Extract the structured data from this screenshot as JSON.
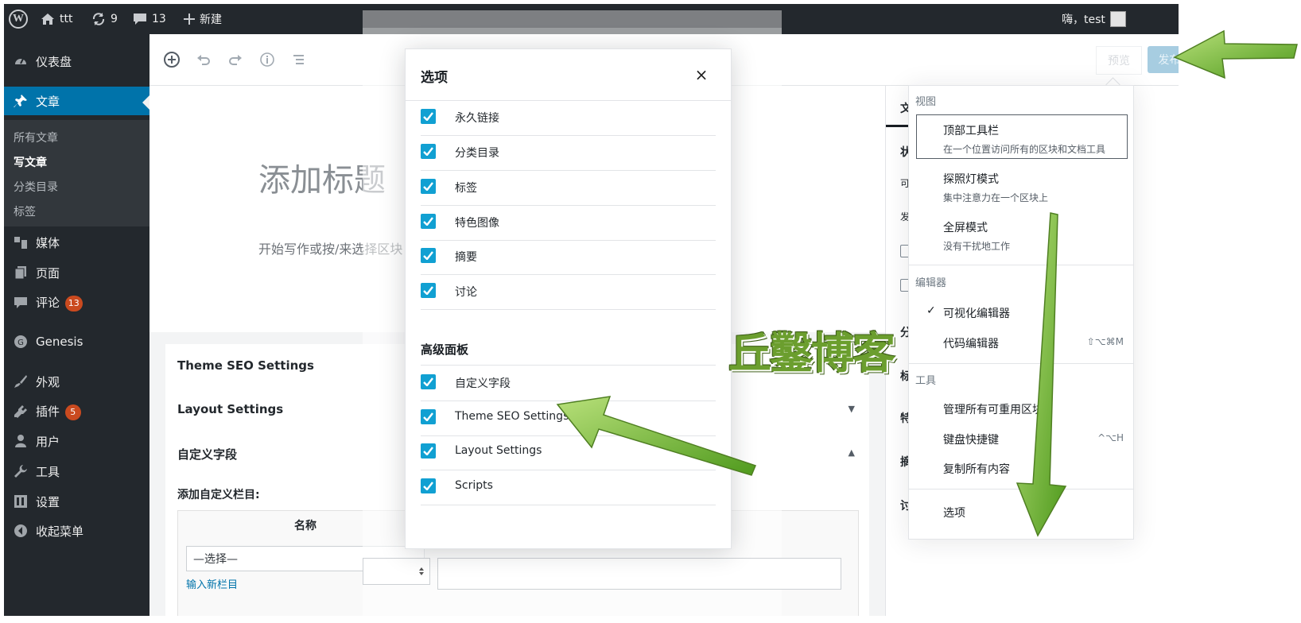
{
  "admin_bar": {
    "site_name": "ttt",
    "updates_count": "9",
    "comments_count": "13",
    "new_label": "新建",
    "greeting": "嗨，test"
  },
  "sidebar": {
    "items": [
      {
        "label": "仪表盘",
        "icon": "dashboard-icon"
      },
      {
        "label": "文章",
        "icon": "pin-icon"
      },
      {
        "label": "媒体",
        "icon": "media-icon"
      },
      {
        "label": "页面",
        "icon": "page-icon"
      },
      {
        "label": "评论",
        "icon": "comment-icon",
        "badge": "13"
      },
      {
        "label": "Genesis",
        "icon": "genesis-icon"
      },
      {
        "label": "外观",
        "icon": "appearance-icon"
      },
      {
        "label": "插件",
        "icon": "plugin-icon",
        "badge": "5"
      },
      {
        "label": "用户",
        "icon": "user-icon"
      },
      {
        "label": "工具",
        "icon": "wrench-icon"
      },
      {
        "label": "设置",
        "icon": "settings-icon"
      },
      {
        "label": "收起菜单",
        "icon": "collapse-icon"
      }
    ],
    "submenu": [
      "所有文章",
      "写文章",
      "分类目录",
      "标签"
    ]
  },
  "toolbar": {
    "preview_label": "预览",
    "publish_label": "发布..."
  },
  "editor": {
    "title_placeholder": "添加标题",
    "paragraph_placeholder": "开始写作或按/来选择区块"
  },
  "meta_boxes": {
    "panels": [
      {
        "title": "Theme SEO Settings",
        "arrow": ""
      },
      {
        "title": "Layout Settings",
        "arrow": "▼"
      },
      {
        "title": "自定义字段",
        "arrow": "▲"
      }
    ],
    "add_custom_label": "添加自定义栏目:",
    "name_header": "名称",
    "select_placeholder": "—选择—",
    "new_link": "输入新栏目"
  },
  "modal": {
    "title": "选项",
    "close": "×",
    "general_options": [
      "永久链接",
      "分类目录",
      "标签",
      "特色图像",
      "摘要",
      "讨论"
    ],
    "advanced_title": "高级面板",
    "advanced_options": [
      "自定义字段",
      "Theme SEO Settings",
      "Layout Settings",
      "Scripts"
    ]
  },
  "settings_sidebar": {
    "fragments": [
      "文",
      "状",
      "可",
      "发",
      "分",
      "标",
      "特",
      "摘",
      "讨"
    ]
  },
  "more_menu": {
    "view_group": "视图",
    "view_items": [
      {
        "label": "顶部工具栏",
        "desc": "在一个位置访问所有的区块和文档工具"
      },
      {
        "label": "探照灯模式",
        "desc": "集中注意力在一个区块上"
      },
      {
        "label": "全屏模式",
        "desc": "没有干扰地工作"
      }
    ],
    "editor_group": "编辑器",
    "editor_items": [
      {
        "label": "可视化编辑器",
        "check": "✓",
        "shortcut": ""
      },
      {
        "label": "代码编辑器",
        "check": "",
        "shortcut": "⇧⌥⌘M"
      }
    ],
    "tools_group": "工具",
    "tools_items": [
      {
        "label": "管理所有可重用区块",
        "shortcut": ""
      },
      {
        "label": "键盘快捷键",
        "shortcut": "^⌥H"
      },
      {
        "label": "复制所有内容",
        "shortcut": ""
      }
    ],
    "options_label": "选项"
  },
  "watermark": "丘鑿博客"
}
